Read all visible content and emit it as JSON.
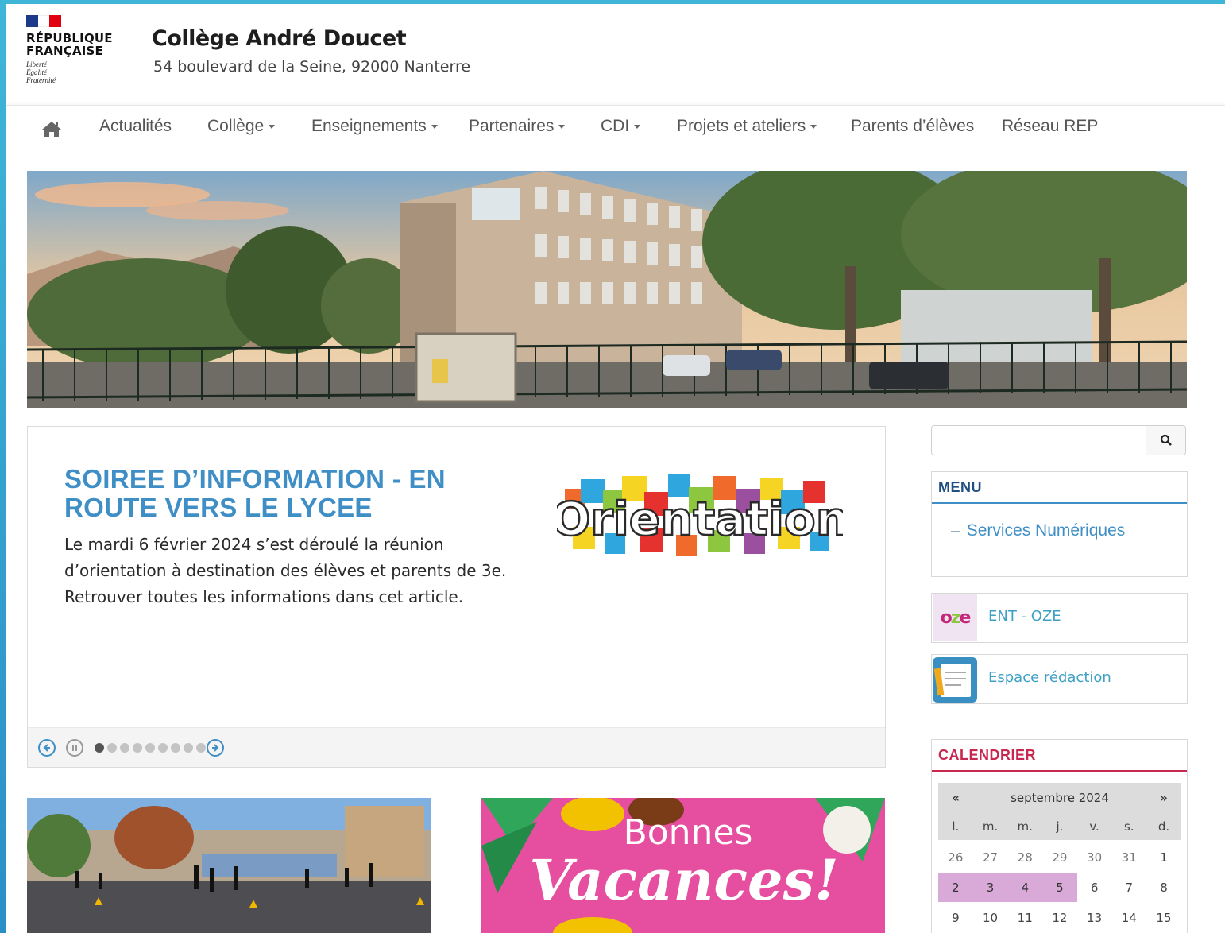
{
  "header": {
    "rf_name_line1": "RÉPUBLIQUE",
    "rf_name_line2": "FRANÇAISE",
    "rf_motto_1": "Liberté",
    "rf_motto_2": "Égalité",
    "rf_motto_3": "Fraternité",
    "title": "Collège André Doucet",
    "address": "54 boulevard de la Seine, 92000 Nanterre"
  },
  "nav": {
    "home_icon": "home-icon",
    "items": [
      {
        "label": "Actualités"
      },
      {
        "label": "Collège"
      },
      {
        "label": "Enseignements"
      },
      {
        "label": "Partenaires"
      },
      {
        "label": "CDI"
      },
      {
        "label": "Projets et ateliers"
      },
      {
        "label": "Parents d’élèves"
      },
      {
        "label": "Réseau REP"
      }
    ]
  },
  "slider": {
    "title": "SOIREE D’INFORMATION - EN ROUTE VERS LE LYCEE",
    "text": "Le mardi 6 février 2024 s’est déroulé la réunion d’orientation à destination des élèves et parents de 3e. Retrouver toutes les informations dans cet article.",
    "image_word": "Orientation",
    "dots_count": 9,
    "active_dot": 1
  },
  "cards": {
    "card2_line1": "Bonnes",
    "card2_line2": "Vacances!"
  },
  "sidebar": {
    "search_placeholder": "",
    "menu_title": "MENU",
    "menu_link": "Services Numériques",
    "ent_label": "ENT - OZE",
    "ent_logo": "oze",
    "redaction_label": "Espace rédaction",
    "calendar_title": "CALENDRIER",
    "calendar": {
      "month": "septembre 2024",
      "prev": "«",
      "next": "»",
      "dow": [
        "l.",
        "m.",
        "m.",
        "j.",
        "v.",
        "s.",
        "d."
      ],
      "rows": [
        [
          "26",
          "27",
          "28",
          "29",
          "30",
          "31",
          "1"
        ],
        [
          "2",
          "3",
          "4",
          "5",
          "6",
          "7",
          "8"
        ],
        [
          "9",
          "10",
          "11",
          "12",
          "13",
          "14",
          "15"
        ]
      ]
    }
  },
  "colors": {
    "accent": "#3f8fc6",
    "calendar_accent": "#c8284f",
    "highlight": "#d9aad8"
  }
}
